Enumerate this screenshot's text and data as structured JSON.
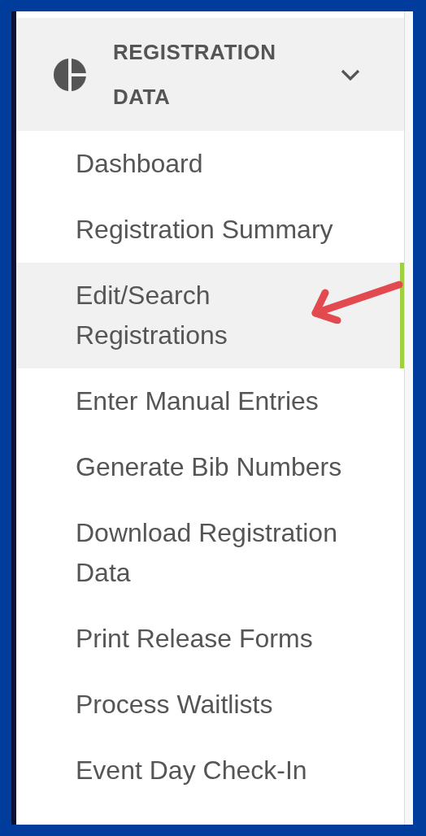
{
  "section": {
    "title": "REGISTRATION DATA",
    "expanded": true
  },
  "items": [
    {
      "label": "Dashboard",
      "selected": false
    },
    {
      "label": "Registration Summary",
      "selected": false
    },
    {
      "label": "Edit/Search Registrations",
      "selected": true
    },
    {
      "label": "Enter Manual Entries",
      "selected": false
    },
    {
      "label": "Generate Bib Numbers",
      "selected": false
    },
    {
      "label": "Download Registration Data",
      "selected": false
    },
    {
      "label": "Print Release Forms",
      "selected": false
    },
    {
      "label": "Process Waitlists",
      "selected": false
    },
    {
      "label": "Event Day Check-In",
      "selected": false
    }
  ]
}
